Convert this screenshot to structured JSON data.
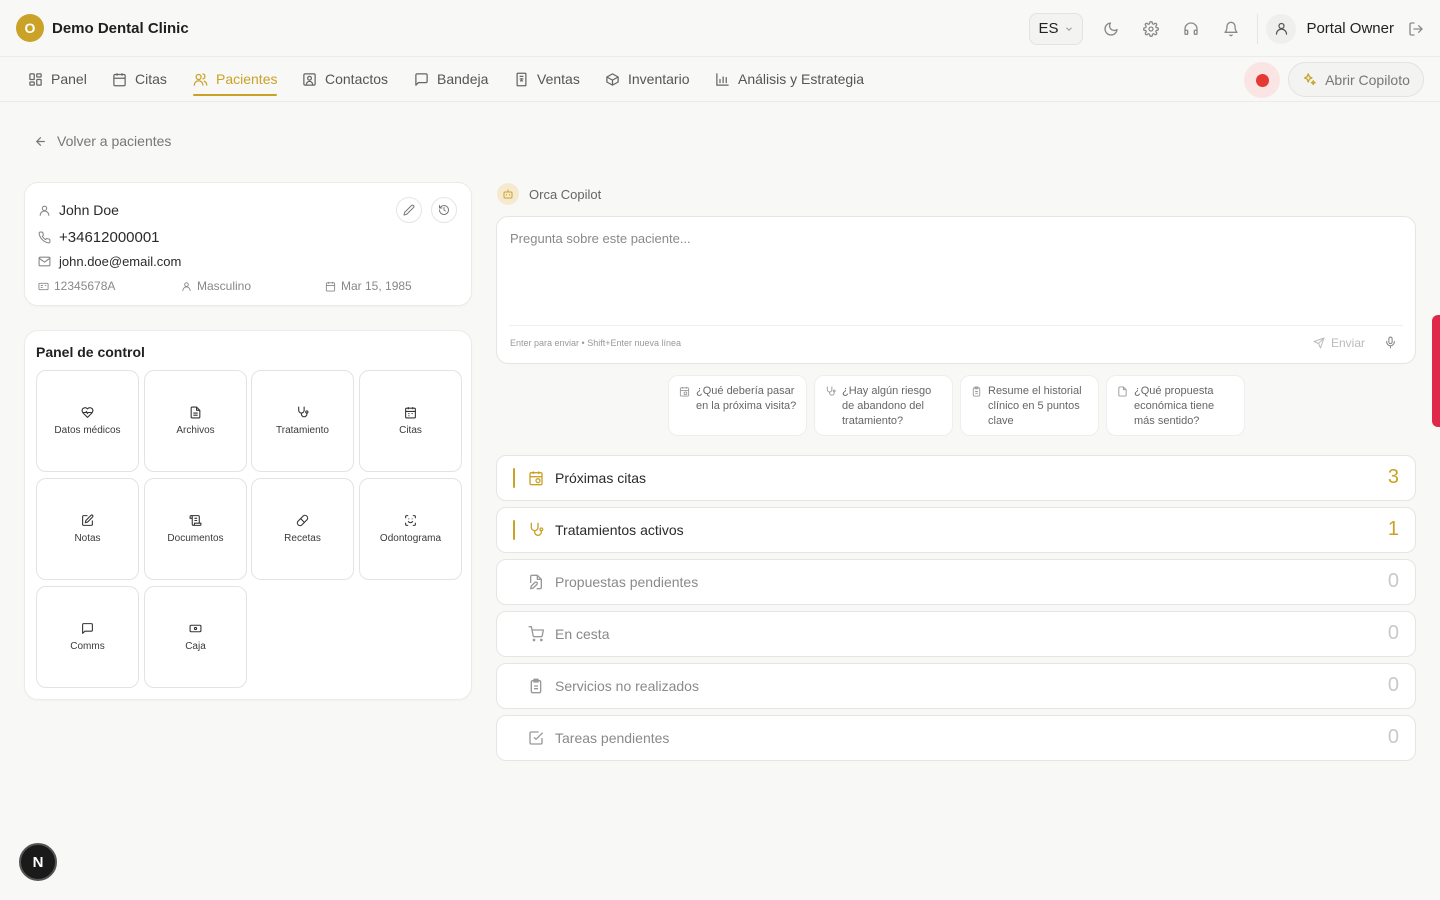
{
  "header": {
    "logo_letter": "O",
    "clinic_name": "Demo Dental Clinic",
    "language": "ES",
    "user_name": "Portal Owner"
  },
  "nav": {
    "items": [
      {
        "label": "Panel",
        "icon": "grid-icon"
      },
      {
        "label": "Citas",
        "icon": "calendar-icon"
      },
      {
        "label": "Pacientes",
        "icon": "users-icon"
      },
      {
        "label": "Contactos",
        "icon": "contact-icon"
      },
      {
        "label": "Bandeja",
        "icon": "message-icon"
      },
      {
        "label": "Ventas",
        "icon": "receipt-icon"
      },
      {
        "label": "Inventario",
        "icon": "box-icon"
      },
      {
        "label": "Análisis y Estrategia",
        "icon": "chart-icon"
      }
    ],
    "active": "Pacientes",
    "copilot_button": "Abrir Copiloto"
  },
  "back_link": "Volver a pacientes",
  "patient": {
    "name": "John Doe",
    "phone": "+34612000001",
    "email": "john.doe@email.com",
    "id_number": "12345678A",
    "gender": "Masculino",
    "birthdate": "Mar 15, 1985"
  },
  "control_panel": {
    "title": "Panel de control",
    "tiles": [
      {
        "label": "Datos médicos",
        "icon": "heart-pulse-icon"
      },
      {
        "label": "Archivos",
        "icon": "file-icon"
      },
      {
        "label": "Tratamiento",
        "icon": "stethoscope-icon"
      },
      {
        "label": "Citas",
        "icon": "calendar-icon"
      },
      {
        "label": "Notas",
        "icon": "note-edit-icon"
      },
      {
        "label": "Documentos",
        "icon": "scroll-icon"
      },
      {
        "label": "Recetas",
        "icon": "pill-icon"
      },
      {
        "label": "Odontograma",
        "icon": "scan-face-icon"
      },
      {
        "label": "Comms",
        "icon": "message-icon"
      },
      {
        "label": "Caja",
        "icon": "cash-icon"
      }
    ]
  },
  "copilot": {
    "title": "Orca Copilot",
    "placeholder": "Pregunta sobre este paciente...",
    "hint": "Enter para enviar • Shift+Enter nueva línea",
    "send_label": "Enviar",
    "suggestions": [
      {
        "text": "¿Qué debería pasar en la próxima visita?",
        "icon": "calendar-clock-icon"
      },
      {
        "text": "¿Hay algún riesgo de abandono del tratamiento?",
        "icon": "stethoscope-icon"
      },
      {
        "text": "Resume el historial clínico en 5 puntos clave",
        "icon": "clipboard-icon"
      },
      {
        "text": "¿Qué propuesta económica tiene más sentido?",
        "icon": "file-icon"
      }
    ]
  },
  "stats": [
    {
      "label": "Próximas citas",
      "value": "3",
      "icon": "calendar-clock-icon",
      "highlight": true
    },
    {
      "label": "Tratamientos activos",
      "value": "1",
      "icon": "stethoscope-icon",
      "highlight": true
    },
    {
      "label": "Propuestas pendientes",
      "value": "0",
      "icon": "file-edit-icon",
      "highlight": false
    },
    {
      "label": "En cesta",
      "value": "0",
      "icon": "cart-icon",
      "highlight": false
    },
    {
      "label": "Servicios no realizados",
      "value": "0",
      "icon": "clipboard-icon",
      "highlight": false
    },
    {
      "label": "Tareas pendientes",
      "value": "0",
      "icon": "check-square-icon",
      "highlight": false
    }
  ],
  "dev_badge": "N",
  "colors": {
    "accent": "#c9a227",
    "record": "#e53935",
    "side_tab": "#e0294a"
  }
}
